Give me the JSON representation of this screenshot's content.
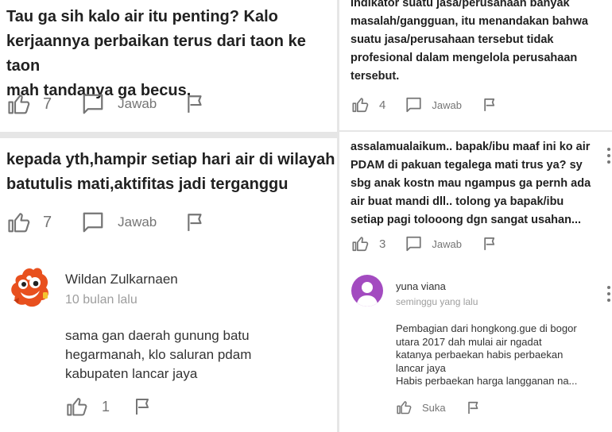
{
  "left": {
    "comment1": {
      "text_lines": [
        "Tau ga sih kalo air itu penting? Kalo",
        "kerjaannya perbaikan terus dari taon ke taon",
        "mah tandanya ga becus."
      ],
      "likes": "7",
      "reply_label": "Jawab"
    },
    "comment2": {
      "text_lines": [
        "kepada yth,hampir setiap hari air di wilayah",
        "batutulis mati,aktifitas jadi terganggu"
      ],
      "likes": "7",
      "reply_label": "Jawab"
    },
    "reply1": {
      "author": "Wildan Zulkarnaen",
      "time": "10 bulan lalu",
      "text_lines": [
        "sama gan daerah gunung batu",
        "hegarmanah, klo saluran pdam",
        "kabupaten lancar jaya"
      ],
      "likes": "1"
    }
  },
  "right": {
    "comment1": {
      "text_lines": [
        "Indikator suatu jasa/perusahaan banyak",
        "masalah/gangguan, itu menandakan bahwa",
        "suatu jasa/perusahaan tersebut tidak",
        "profesional dalam mengelola perusahaan",
        "tersebut."
      ],
      "likes": "4",
      "reply_label": "Jawab"
    },
    "comment2": {
      "text_lines": [
        "assalamualaikum.. bapak/ibu maaf ini ko air",
        "PDAM di pakuan tegalega mati trus ya? sy",
        "sbg anak kostn mau ngampus ga pernh ada",
        "air buat mandi dll.. tolong ya bapak/ibu",
        "setiap pagi tolooong dgn sangat usahan..."
      ],
      "likes": "3",
      "reply_label": "Jawab"
    },
    "reply1": {
      "author": "yuna viana",
      "time": "seminggu yang lalu",
      "text_lines": [
        "Pembagian dari hongkong.gue di bogor",
        "utara 2017 dah mulai air ngadat",
        "katanya perbaekan habis perbaekan",
        "lancar jaya",
        "Habis perbaekan harga langganan na..."
      ],
      "like_label": "Suka"
    }
  },
  "icons": {
    "like": "thumbs-up-icon",
    "reply": "comment-icon",
    "report": "flag-icon",
    "more": "more-vert-icon"
  },
  "colors": {
    "icon": "#757575",
    "separator": "#e6e6e6",
    "avatar_purple": "#a34bc0",
    "mascot_orange": "#e8501e"
  }
}
